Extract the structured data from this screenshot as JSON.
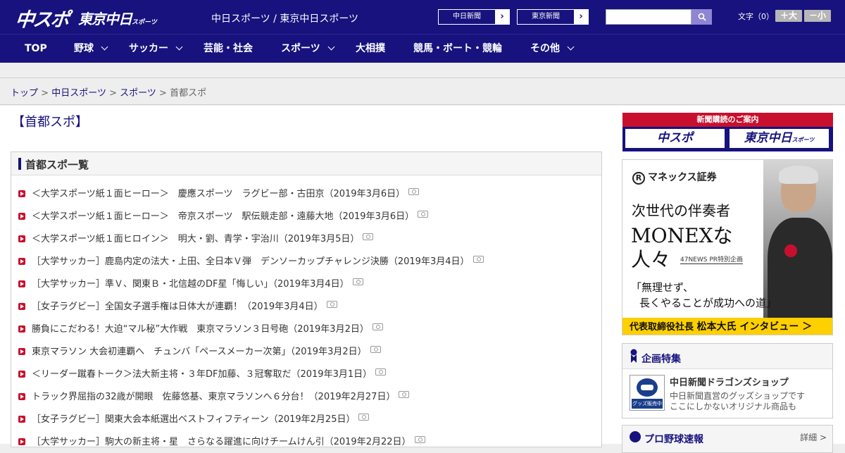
{
  "header": {
    "logo_chuspo": "中スポ",
    "logo_tokyo": "東京中日",
    "logo_tokyo_small": "スポーツ",
    "site_names": "中日スポーツ / 東京中日スポーツ",
    "ext_buttons": [
      "中日新聞",
      "東京新聞"
    ],
    "font_size_label": "文字（0）",
    "font_plus": "＋大",
    "font_minus": "－小"
  },
  "nav": {
    "items": [
      {
        "label": "TOP"
      },
      {
        "label": "野球"
      },
      {
        "label": "サッカー"
      },
      {
        "label": "芸能・社会"
      },
      {
        "label": "スポーツ"
      },
      {
        "label": "大相撲"
      },
      {
        "label": "競馬・ボート・競輪"
      },
      {
        "label": "その他"
      }
    ]
  },
  "breadcrumb": {
    "items": [
      "トップ",
      "中日スポーツ",
      "スポーツ"
    ],
    "separator": ">",
    "current": "首都スポ"
  },
  "page_title": "【首都スポ】",
  "list": {
    "title": "首都スポ一覧",
    "articles": [
      "＜大学スポーツ紙１面ヒーロー＞　慶應スポーツ　ラグビー部・古田京（2019年3月6日）",
      "＜大学スポーツ紙１面ヒーロー＞　帝京スポーツ　駅伝競走部・遠藤大地（2019年3月6日）",
      "＜大学スポーツ紙１面ヒロイン＞　明大・劉、青学・宇治川（2019年3月5日）",
      "［大学サッカー］鹿島内定の法大・上田、全日本Ｖ弾　デンソーカップチャレンジ決勝（2019年3月4日）",
      "［大学サッカー］準Ｖ、関東Ｂ・北信越のDF星「悔しい」（2019年3月4日）",
      "［女子ラグビー］全国女子選手権は日体大が連覇！（2019年3月4日）",
      "勝負にこだわる！大迫“マル秘”大作戦　東京マラソン３日号砲（2019年3月2日）",
      "東京マラソン 大会初連覇へ　チュンバ「ペースメーカー次第」（2019年3月2日）",
      "＜リーダー蹴春トーク＞法大新主将・３年DF加藤、３冠奪取だ（2019年3月1日）",
      "トラック界屈指の32歳が開眼　佐藤悠基、東京マラソンへ６分台！（2019年2月27日）",
      "［女子ラグビー］関東大会本紙選出ベストフィフティーン（2019年2月25日）",
      "［大学サッカー］駒大の新主将・星　さらなる躍進に向けチームけん引（2019年2月22日）"
    ]
  },
  "sidebar": {
    "subscribe_title": "新聞購読のご案内",
    "subscribe_buttons": [
      "中スポ",
      "東京中日"
    ],
    "subscribe_small": "スポーツ",
    "ad": {
      "brand": "マネックス証券",
      "line1": "次世代の伴奏者",
      "line2": "MONEXな",
      "line3": "人々",
      "tag": "47NEWS PR特別企画",
      "quote1": "「無理せず、",
      "quote2": "長くやることが成功への道」",
      "bottom_prefix": "代表取締役社長",
      "bottom_name": "松本大氏 インタビュー ＞"
    },
    "feature": {
      "title": "企画特集",
      "shop_img_label": "グッズ販売中",
      "shop_title": "中日新聞ドラゴンズショップ",
      "shop_desc1": "中日新聞直営のグッズショップです",
      "shop_desc2": "ここにしかないオリジナル商品も"
    },
    "baseball": {
      "title": "プロ野球速報",
      "more": "詳細 >"
    }
  }
}
